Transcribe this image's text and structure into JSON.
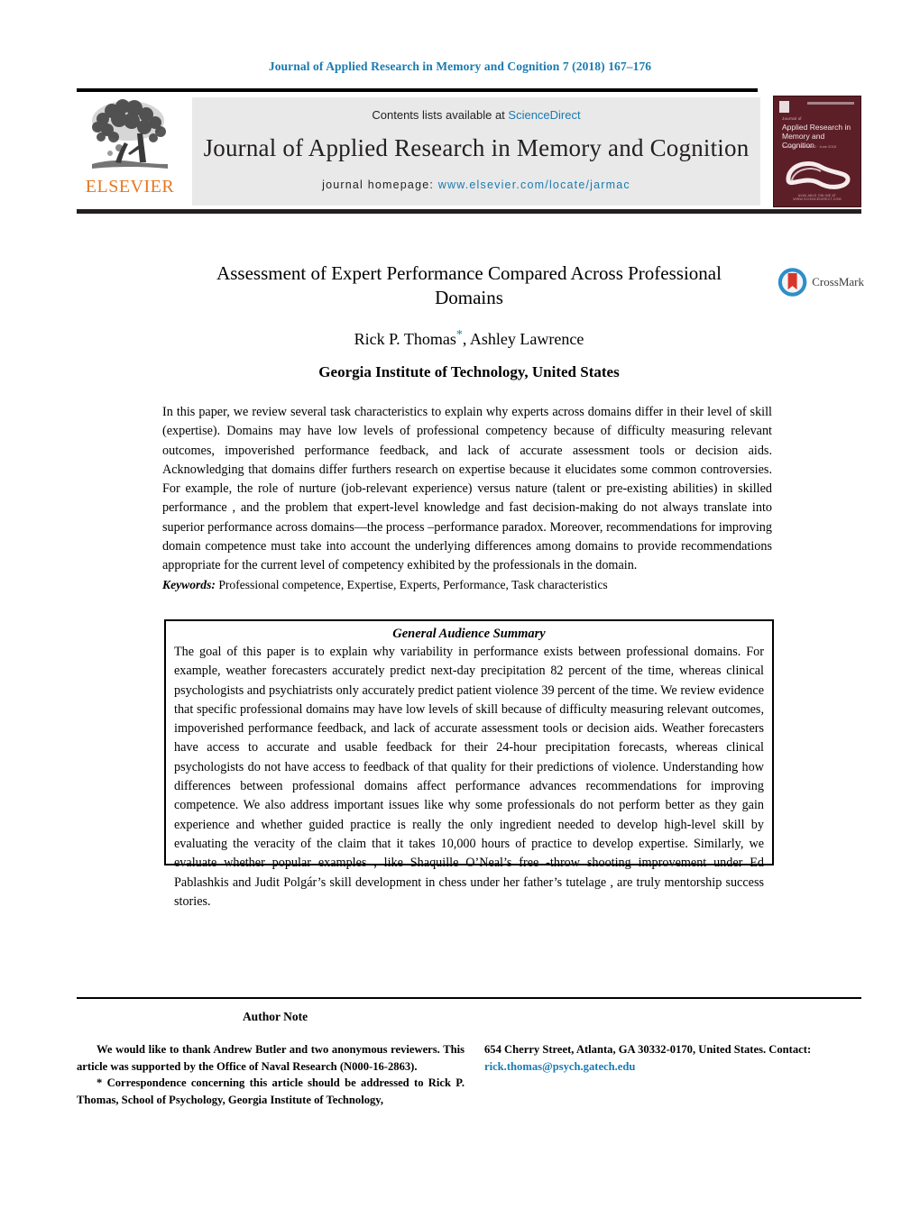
{
  "running_head": "Journal of Applied Research in Memory and Cognition 7 (2018) 167–176",
  "masthead": {
    "contents_prefix": "Contents lists available at ",
    "sciencedirect_link": "ScienceDirect",
    "journal_name": "Journal of Applied Research in Memory and Cognition",
    "homepage_label": "journal homepage: ",
    "homepage_url": "www.elsevier.com/locate/jarmac",
    "publisher_wordmark": "ELSEVIER",
    "publisher_accent_color": "#e87722",
    "link_color": "#1a7bb0"
  },
  "cover": {
    "kicker": "Journal of",
    "title": "Applied Research in Memory and Cognition",
    "subtitle": "Volume 7 · Number 2 · June 2018",
    "footer": "AVAILABLE ONLINE AT WWW.SCIENCEDIRECT.COM",
    "background_color": "#5c1f28"
  },
  "article": {
    "title": "Assessment of Expert Performance Compared Across Professional Domains",
    "authors": "Rick P. Thomas",
    "author_marker": "*",
    "authors_rest": ", Ashley Lawrence",
    "affiliation": "Georgia Institute of Technology, United States"
  },
  "crossmark": {
    "label": "CrossMark"
  },
  "abstract": {
    "text": "In this paper, we review several task characteristics to explain why experts across domains differ in their level of skill (expertise). Domains may have low levels of professional competency because of difficulty measuring relevant outcomes, impoverished performance feedback, and lack of accurate assessment tools or decision aids. Acknowledging that domains differ furthers research on expertise because it elucidates some common controversies. For example, the role of nurture (job-relevant experience) versus nature (talent or pre-existing abilities) in skilled performance , and the problem that expert-level knowledge and fast decision-making do not always translate into superior performance across domains—the process –performance paradox. Moreover, recommendations for improving domain competence must take into account the underlying differences among domains to provide recommendations appropriate for the current level of competency exhibited by the professionals in the domain."
  },
  "keywords": {
    "label": "Keywords:",
    "values": "Professional competence, Expertise, Experts, Performance, Task characteristics"
  },
  "general_audience_summary": {
    "heading": "General Audience Summary",
    "body": "The goal of this paper is to explain why variability in performance exists between professional domains. For example, weather forecasters accurately predict next-day precipitation 82 percent of the time, whereas clinical psychologists and psychiatrists only accurately predict patient violence 39 percent of the time. We review evidence that specific professional domains may have low levels of skill because of difficulty measuring relevant outcomes, impoverished performance feedback, and lack of accurate assessment tools or decision aids. Weather forecasters have access to accurate and usable feedback for their 24-hour precipitation forecasts, whereas clinical psychologists do not have access to feedback of that quality for their predictions of violence. Understanding how differences between professional domains affect performance advances recommendations for improving competence. We also address important issues like why some professionals do not perform better as they gain experience and whether guided practice is really the only ingredient needed to develop high-level skill by evaluating the veracity of the claim that it takes 10,000 hours of practice to develop expertise. Similarly, we evaluate whether popular examples , like Shaquille O’Neal’s free -throw shooting improvement under Ed Pablashkis and Judit Polgár’s skill development in chess under her father’s tutelage , are truly mentorship success stories."
  },
  "author_note": {
    "heading": "Author Note",
    "acknowledgement": "We would like to thank Andrew Butler and two anonymous reviewers. This article was supported by the Office of Naval Research (N000-16-2863).",
    "correspondence": "* Correspondence concerning this article should be addressed to Rick P. Thomas, School of Psychology, Georgia Institute of Technology,",
    "address": "654 Cherry Street, Atlanta, GA 30332-0170, United States. Contact:",
    "email": "rick.thomas@psych.gatech.edu"
  }
}
